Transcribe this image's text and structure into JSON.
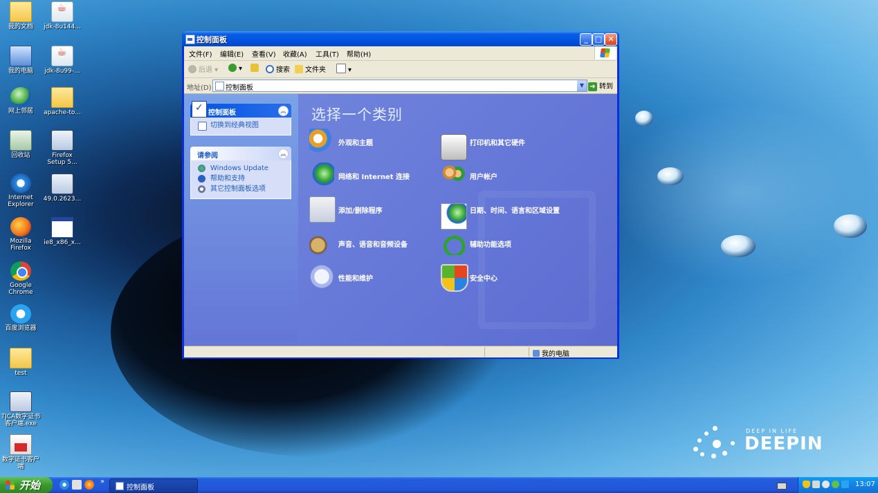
{
  "desktop": {
    "icons": [
      {
        "label": "我的文档",
        "icon": "folder-icon"
      },
      {
        "label": "jdk-8u144...",
        "icon": "java-installer-icon"
      },
      {
        "label": "我的电脑",
        "icon": "computer-icon"
      },
      {
        "label": "jdk-8u99-...",
        "icon": "java-installer-icon"
      },
      {
        "label": "网上邻居",
        "icon": "network-icon"
      },
      {
        "label": "apache-to...",
        "icon": "folder-shortcut-icon"
      },
      {
        "label": "回收站",
        "icon": "recycle-bin-icon"
      },
      {
        "label": "Firefox Setup 5...",
        "icon": "firefox-setup-icon"
      },
      {
        "label": "Internet Explorer",
        "icon": "internet-explorer-icon"
      },
      {
        "label": "49.0.2623...",
        "icon": "installer-icon"
      },
      {
        "label": "Mozilla Firefox",
        "icon": "firefox-icon"
      },
      {
        "label": "ie8_x86_x...",
        "icon": "window-app-icon"
      },
      {
        "label": "Google Chrome",
        "icon": "chrome-icon"
      },
      {
        "label": "百度浏览器",
        "icon": "baidu-browser-icon"
      },
      {
        "label": "test",
        "icon": "folder-icon"
      },
      {
        "label": "TJCA数字证书客户端.exe",
        "icon": "cert-client-icon"
      },
      {
        "label": "数字证书客户端",
        "icon": "cert-icon"
      }
    ],
    "brand": {
      "tagline": "DEEP IN LIFE",
      "name": "DEEPIN"
    }
  },
  "window": {
    "title": "控制面板",
    "menu": [
      "文件(F)",
      "编辑(E)",
      "查看(V)",
      "收藏(A)",
      "工具(T)",
      "帮助(H)"
    ],
    "toolbar": {
      "back": "后退",
      "search": "搜索",
      "folders": "文件夹"
    },
    "address": {
      "label": "地址(D)",
      "value": "控制面板",
      "go": "转到"
    },
    "taskpane": {
      "panel1_title": "控制面板",
      "panel1_links": [
        "切换到经典视图"
      ],
      "panel2_title": "请参阅",
      "panel2_links": [
        "Windows Update",
        "帮助和支持",
        "其它控制面板选项"
      ]
    },
    "main_title": "选择一个类别",
    "categories": [
      {
        "label": "外观和主题",
        "icon": "appearance-themes-icon"
      },
      {
        "label": "网络和 Internet 连接",
        "icon": "network-internet-icon"
      },
      {
        "label": "添加/删除程序",
        "icon": "add-remove-programs-icon"
      },
      {
        "label": "声音、语音和音频设备",
        "icon": "sound-audio-icon"
      },
      {
        "label": "性能和维护",
        "icon": "performance-maintenance-icon"
      },
      {
        "label": "打印机和其它硬件",
        "icon": "printer-hardware-icon"
      },
      {
        "label": "用户帐户",
        "icon": "user-accounts-icon"
      },
      {
        "label": "日期、时间、语言和区域设置",
        "icon": "date-time-language-icon"
      },
      {
        "label": "辅助功能选项",
        "icon": "accessibility-icon"
      },
      {
        "label": "安全中心",
        "icon": "security-center-icon"
      }
    ],
    "status": {
      "zone": "我的电脑"
    }
  },
  "taskbar": {
    "start": "开始",
    "task_button": "控制面板",
    "clock": "13:07"
  }
}
